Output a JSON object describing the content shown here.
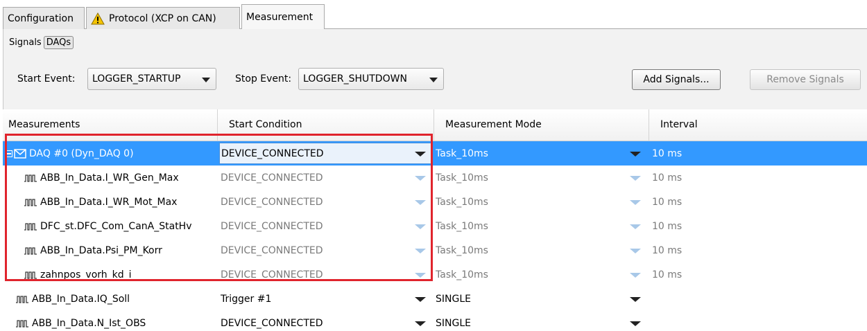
{
  "tabs": [
    {
      "label": "Configuration",
      "icon": ""
    },
    {
      "label": "Protocol (XCP on CAN)",
      "icon": "warning-icon"
    },
    {
      "label": "Measurement",
      "icon": ""
    }
  ],
  "subtabs": {
    "signals_label": "Signals",
    "daqs_label": "DAQs"
  },
  "controls": {
    "start_event_label": "Start Event:",
    "start_event_value": "LOGGER_STARTUP",
    "stop_event_label": "Stop Event:",
    "stop_event_value": "LOGGER_SHUTDOWN",
    "add_signals_label": "Add Signals...",
    "remove_signals_label": "Remove Signals"
  },
  "table": {
    "columns": [
      "Measurements",
      "Start Condition",
      "Measurement Mode",
      "Interval"
    ],
    "rows": [
      {
        "name": "DAQ #0 (Dyn_DAQ 0)",
        "start": "DEVICE_CONNECTED",
        "mode": "Task_10ms",
        "interval": "10 ms"
      },
      {
        "name": "ABB_In_Data.I_WR_Gen_Max",
        "start": "DEVICE_CONNECTED",
        "mode": "Task_10ms",
        "interval": "10 ms"
      },
      {
        "name": "ABB_In_Data.I_WR_Mot_Max",
        "start": "DEVICE_CONNECTED",
        "mode": "Task_10ms",
        "interval": "10 ms"
      },
      {
        "name": "DFC_st.DFC_Com_CanA_StatHv",
        "start": "DEVICE_CONNECTED",
        "mode": "Task_10ms",
        "interval": "10 ms"
      },
      {
        "name": "ABB_In_Data.Psi_PM_Korr",
        "start": "DEVICE_CONNECTED",
        "mode": "Task_10ms",
        "interval": "10 ms"
      },
      {
        "name": "zahnpos_vorh_kd_i",
        "start": "DEVICE_CONNECTED",
        "mode": "Task_10ms",
        "interval": "10 ms"
      },
      {
        "name": "ABB_In_Data.IQ_Soll",
        "start": "Trigger #1",
        "mode": "SINGLE",
        "interval": ""
      },
      {
        "name": "ABB_In_Data.N_Ist_OBS",
        "start": "DEVICE_CONNECTED",
        "mode": "SINGLE",
        "interval": ""
      }
    ]
  },
  "colors": {
    "selection": "#3399ff",
    "highlight": "#e0242d"
  }
}
